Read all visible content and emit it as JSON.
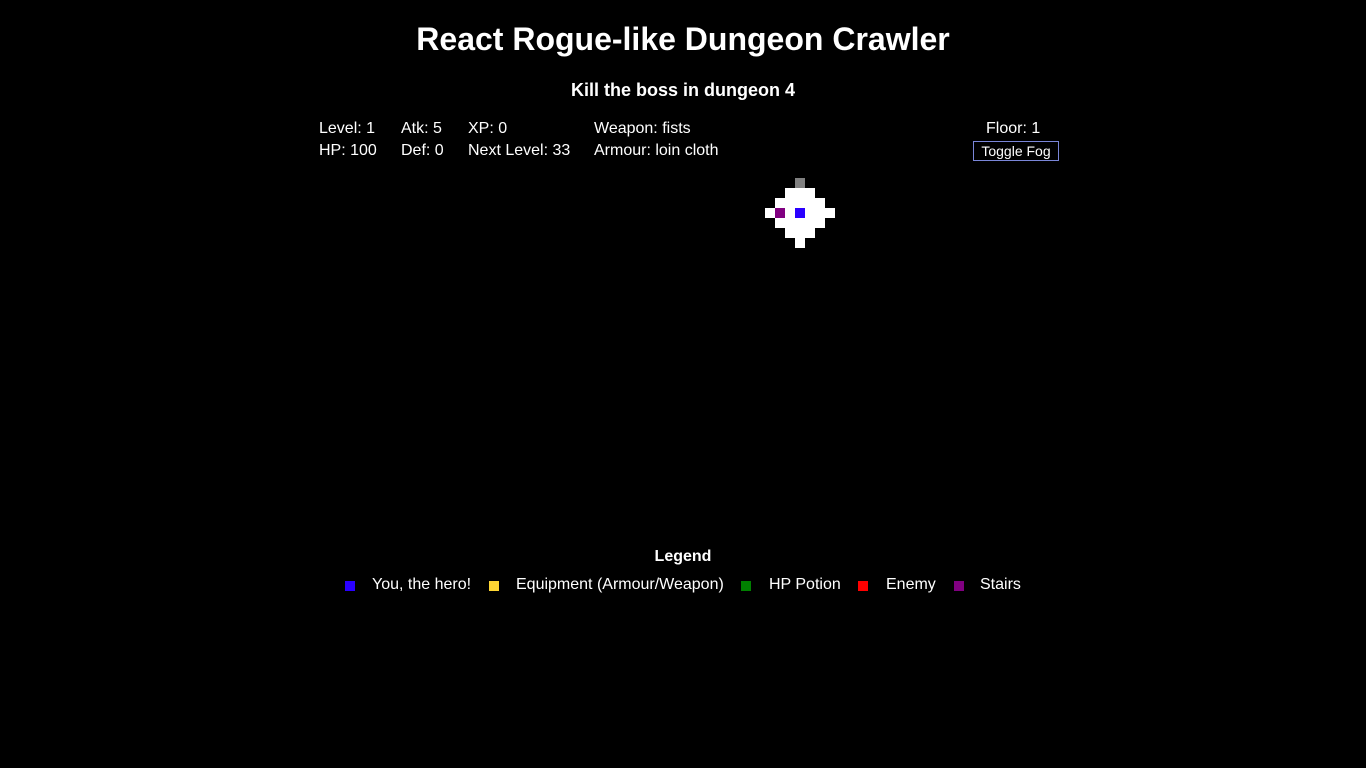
{
  "header": {
    "title": "React Rogue-like Dungeon Crawler",
    "objective": "Kill the boss in dungeon 4"
  },
  "stats": {
    "level": "Level: 1",
    "hp": "HP: 100",
    "atk": "Atk: 5",
    "def": "Def: 0",
    "xp": "XP: 0",
    "next_level": "Next Level: 33",
    "weapon": "Weapon: fists",
    "armour": "Armour: loin cloth",
    "floor": "Floor: 1"
  },
  "controls": {
    "toggle_fog_label": "Toggle Fog"
  },
  "map": {
    "colors": {
      "floor": "#ffffff",
      "wall": "#808080",
      "hero": "#2a00ff",
      "stairs": "#800080"
    }
  },
  "legend": {
    "title": "Legend",
    "items": [
      {
        "label": "You, the hero!",
        "color": "#2a00ff"
      },
      {
        "label": "Equipment (Armour/Weapon)",
        "color": "#ffd633"
      },
      {
        "label": "HP Potion",
        "color": "#008000"
      },
      {
        "label": "Enemy",
        "color": "#ff0000"
      },
      {
        "label": "Stairs",
        "color": "#800080"
      }
    ]
  }
}
